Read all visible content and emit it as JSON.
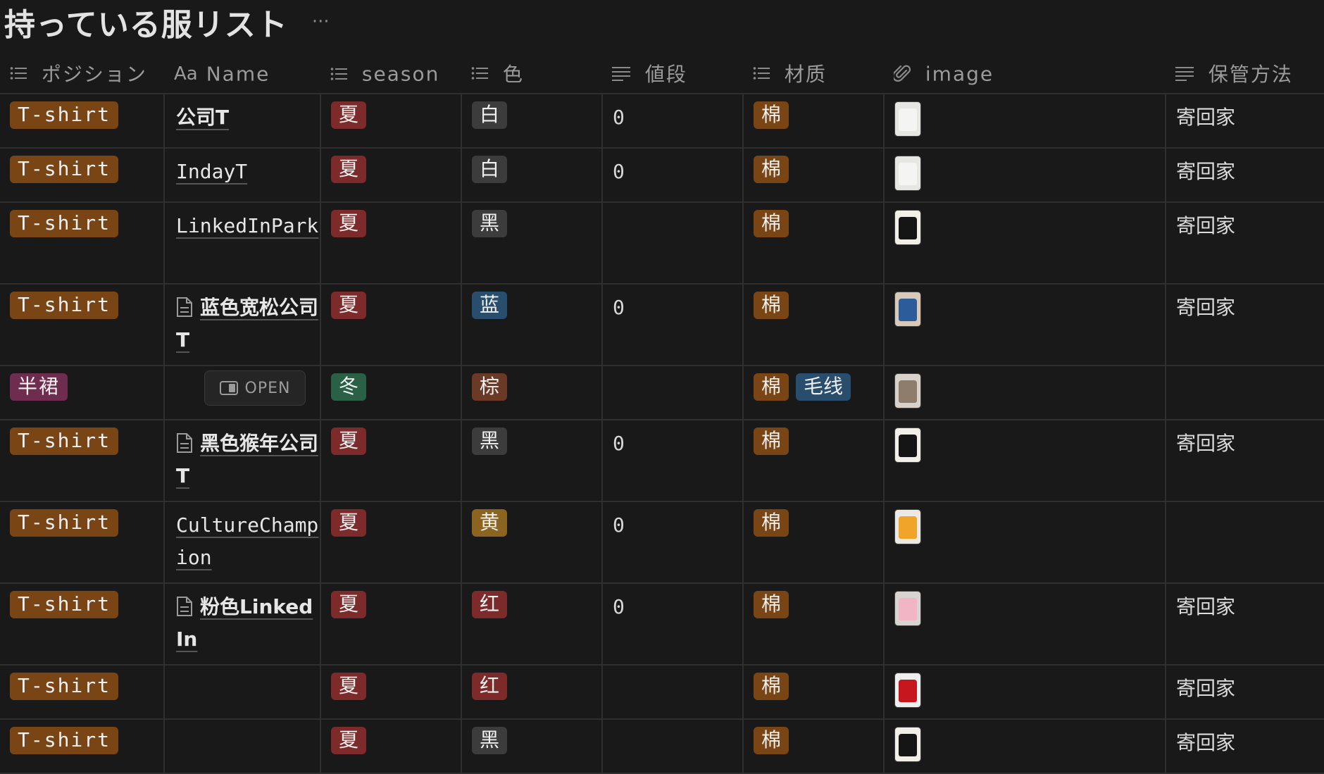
{
  "page": {
    "title": "持っている服リスト",
    "more_label": "···"
  },
  "columns": [
    {
      "label": "ポジション",
      "icon": "list-icon"
    },
    {
      "label": "Name",
      "prefix": "Aa",
      "icon": "title-icon"
    },
    {
      "label": "season",
      "icon": "list-icon"
    },
    {
      "label": "色",
      "icon": "list-icon"
    },
    {
      "label": "値段",
      "icon": "text-icon"
    },
    {
      "label": "材质",
      "icon": "list-icon"
    },
    {
      "label": "image",
      "icon": "paperclip-icon"
    },
    {
      "label": "保管方法",
      "icon": "text-icon"
    }
  ],
  "open_label": "OPEN",
  "colors": {
    "tshirt": "#7a4514",
    "skirt": "#6e2d4e",
    "summer": "#7d2a2a",
    "winter": "#2a6046",
    "gray": "#3c3c3c",
    "blue": "#284d6d",
    "brown": "#6a3a27",
    "yellow": "#8b6420",
    "red": "#7d2a2a"
  },
  "rows": [
    {
      "position": "T-shirt",
      "name": "公司T",
      "doc": false,
      "season": "夏",
      "color": "白",
      "price": "0",
      "material": [
        "棉"
      ],
      "thumb": "white-shirt",
      "storage": "寄回家"
    },
    {
      "position": "T-shirt",
      "name": "IndayT",
      "doc": false,
      "season": "夏",
      "color": "白",
      "price": "0",
      "material": [
        "棉"
      ],
      "thumb": "white-shirt",
      "storage": "寄回家"
    },
    {
      "position": "T-shirt",
      "name": "LinkedInPark",
      "doc": false,
      "season": "夏",
      "color": "黑",
      "price": "",
      "material": [
        "棉"
      ],
      "thumb": "black-shirt",
      "storage": "寄回家"
    },
    {
      "position": "T-shirt",
      "name": "蓝色宽松公司T",
      "doc": true,
      "season": "夏",
      "color": "蓝",
      "price": "0",
      "material": [
        "棉"
      ],
      "thumb": "blue-shirt",
      "storage": "寄回家"
    },
    {
      "position": "半裙",
      "name": "",
      "doc": false,
      "season": "冬",
      "color": "棕",
      "price": "",
      "material": [
        "棉",
        "毛线"
      ],
      "thumb": "brown-skirt",
      "storage": ""
    },
    {
      "position": "T-shirt",
      "name": "黑色猴年公司T",
      "doc": true,
      "season": "夏",
      "color": "黑",
      "price": "0",
      "material": [
        "棉"
      ],
      "thumb": "black-shirt",
      "storage": "寄回家"
    },
    {
      "position": "T-shirt",
      "name": "CultureChampion",
      "doc": false,
      "season": "夏",
      "color": "黄",
      "price": "0",
      "material": [
        "棉"
      ],
      "thumb": "yellow-shirt",
      "storage": ""
    },
    {
      "position": "T-shirt",
      "name": "粉色LinkedIn",
      "doc": true,
      "season": "夏",
      "color": "红",
      "price": "0",
      "material": [
        "棉"
      ],
      "thumb": "pink-shirt",
      "storage": "寄回家"
    },
    {
      "position": "T-shirt",
      "name": "",
      "doc": false,
      "season": "夏",
      "color": "红",
      "price": "",
      "material": [
        "棉"
      ],
      "thumb": "red-shirt",
      "storage": "寄回家"
    },
    {
      "position": "T-shirt",
      "name": "",
      "doc": false,
      "season": "夏",
      "color": "黑",
      "price": "",
      "material": [
        "棉"
      ],
      "thumb": "black-shirt",
      "storage": "寄回家"
    }
  ]
}
